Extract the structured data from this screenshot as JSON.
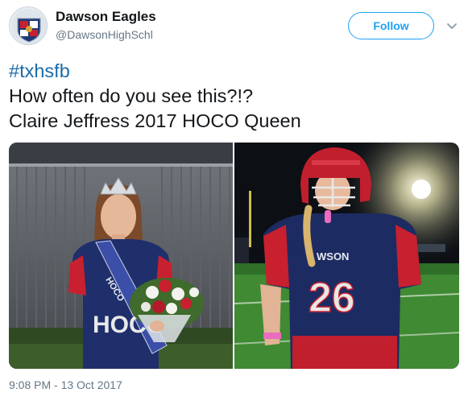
{
  "tweet": {
    "author": {
      "display_name": "Dawson Eagles",
      "handle": "@DawsonHighSchl"
    },
    "follow_label": "Follow",
    "text": {
      "hashtag": "#txhsfb",
      "line2": "How often do you see this?!?",
      "line3": "Claire Jeffress 2017 HOCO Queen"
    },
    "media": {
      "left_photo": {
        "jersey_letters": "HOCO",
        "sash_text": "HOCO"
      },
      "right_photo": {
        "jersey_number": "26",
        "jersey_text": "WSON"
      }
    },
    "timestamp": "9:08 PM - 13 Oct 2017"
  },
  "colors": {
    "accent": "#1da1f2",
    "hashtag": "#1b6ca8",
    "secondary_text": "#657786",
    "primary_text": "#14171a"
  },
  "icons": {
    "avatar": "eagles-crest-icon",
    "caret": "chevron-down-icon"
  }
}
